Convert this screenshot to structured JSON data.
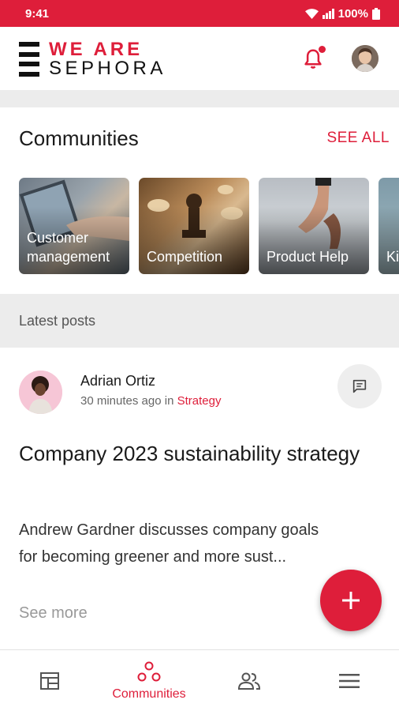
{
  "status_bar": {
    "time": "9:41",
    "battery": "100%"
  },
  "header": {
    "logo_line1": "WE ARE",
    "logo_line2": "SEPHORA"
  },
  "communities": {
    "title": "Communities",
    "see_all": "SEE ALL",
    "cards": [
      {
        "label": "Customer management"
      },
      {
        "label": "Competition"
      },
      {
        "label": "Product Help"
      },
      {
        "label": "Ki"
      }
    ]
  },
  "latest": {
    "label": "Latest posts"
  },
  "post": {
    "author": "Adrian Ortiz",
    "time": "30 minutes ago in",
    "community": "Strategy",
    "title": "Company 2023 sustainability strategy",
    "excerpt": "Andrew Gardner discusses company goals for becoming greener and more sust...",
    "see_more": "See more"
  },
  "nav": {
    "active_label": "Communities",
    "items": [
      {
        "icon": "feed-icon"
      },
      {
        "icon": "communities-icon"
      },
      {
        "icon": "people-icon"
      },
      {
        "icon": "menu-icon"
      }
    ]
  },
  "colors": {
    "brand": "#de1e3a"
  }
}
